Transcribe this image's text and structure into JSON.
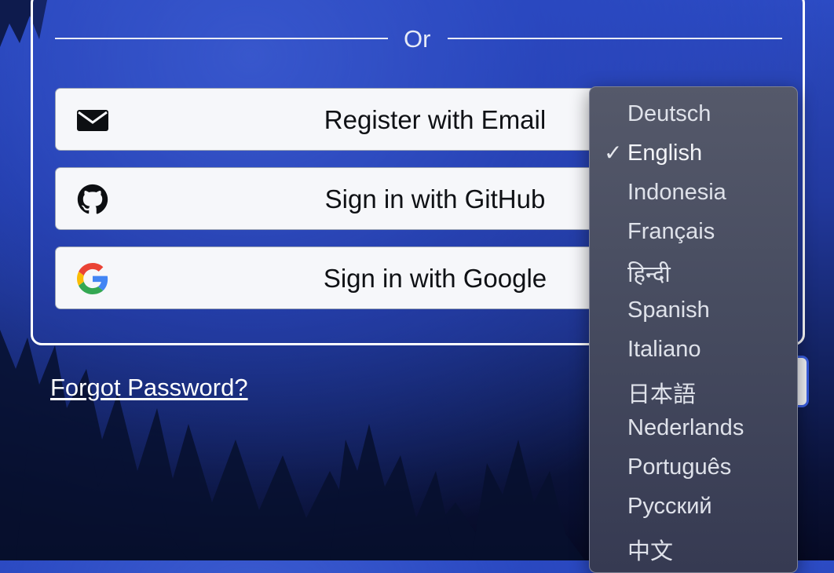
{
  "divider": {
    "text": "Or"
  },
  "auth_buttons": [
    {
      "label": "Register with Email",
      "icon": "envelope-icon"
    },
    {
      "label": "Sign in with GitHub",
      "icon": "github-icon"
    },
    {
      "label": "Sign in with Google",
      "icon": "google-icon"
    }
  ],
  "forgot_password": "Forgot Password?",
  "language_menu": {
    "selected": "English",
    "check_mark": "✓",
    "items": [
      "Deutsch",
      "English",
      "Indonesia",
      "Français",
      "हिन्दी",
      "Spanish",
      "Italiano",
      "日本語",
      "Nederlands",
      "Português",
      "Русский",
      "中文"
    ]
  },
  "colors": {
    "background_top": "#2c4bc4",
    "background_bottom": "#060a24",
    "button_bg": "#f6f7fa",
    "menu_bg": "#474c60",
    "select_focus_ring": "#3a5fe3"
  }
}
